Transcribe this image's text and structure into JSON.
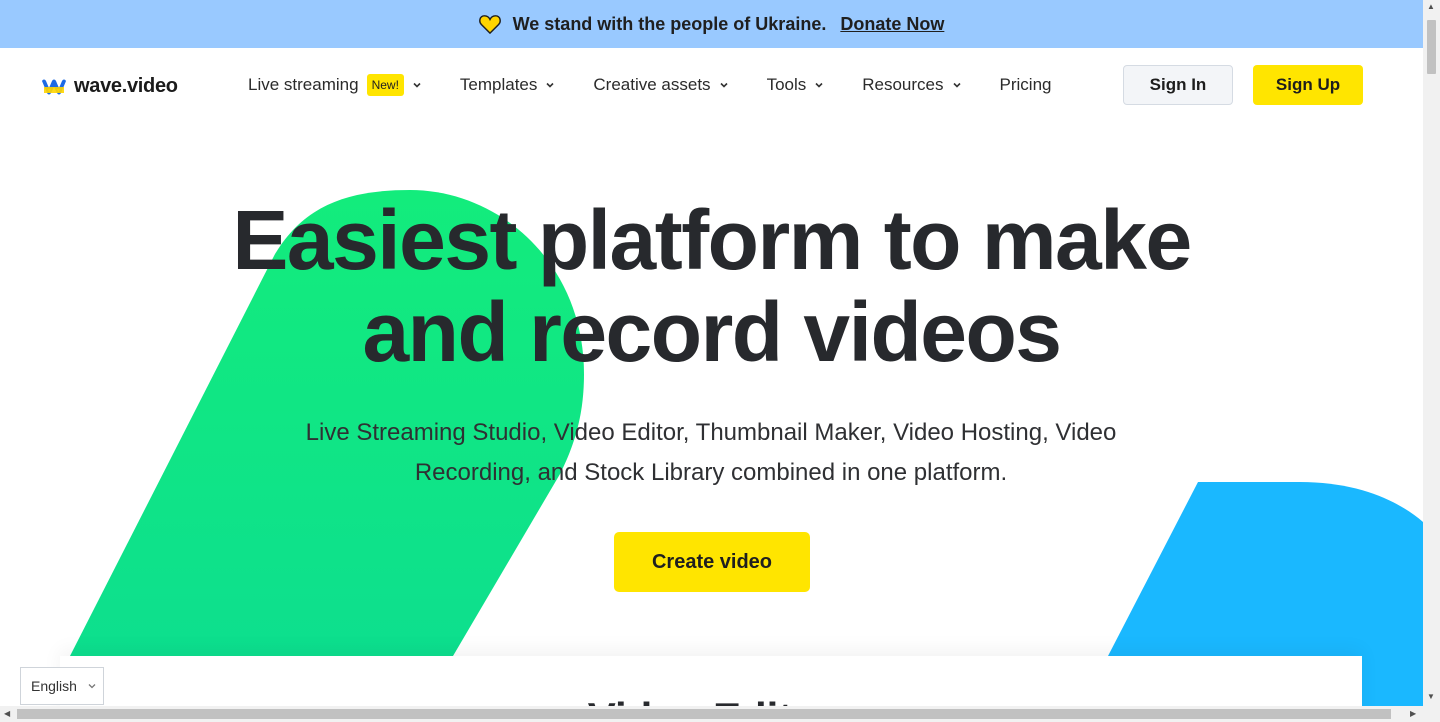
{
  "banner": {
    "message": "We stand with the people of Ukraine.",
    "link": "Donate Now",
    "bg_color": "#99c9ff",
    "icon": "heart-icon"
  },
  "header": {
    "logo_text": "wave.video",
    "nav": [
      {
        "label": "Live streaming",
        "badge": "New!",
        "dropdown": true
      },
      {
        "label": "Templates",
        "dropdown": true
      },
      {
        "label": "Creative assets",
        "dropdown": true
      },
      {
        "label": "Tools",
        "dropdown": true
      },
      {
        "label": "Resources",
        "dropdown": true
      },
      {
        "label": "Pricing",
        "dropdown": false
      }
    ],
    "signin_label": "Sign In",
    "signup_label": "Sign Up"
  },
  "hero": {
    "title_line1": "Easiest platform to make",
    "title_line2": "and record videos",
    "subtitle_line1": "Live Streaming Studio, Video Editor, Thumbnail Maker, Video Hosting, Video",
    "subtitle_line2": "Recording, and Stock Library combined in one platform.",
    "cta_label": "Create video",
    "accent_color": "#ffe500",
    "green_color": "#11e480",
    "blue_color": "#1ab8ff"
  },
  "card": {
    "title": "Video Editor"
  },
  "language": {
    "selected": "English"
  }
}
